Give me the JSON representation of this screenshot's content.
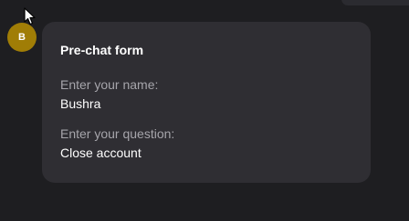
{
  "avatar": {
    "initial": "B",
    "color": "#a07d06"
  },
  "prechat_form": {
    "title": "Pre-chat form",
    "fields": [
      {
        "label": "Enter your name:",
        "value": "Bushra"
      },
      {
        "label": "Enter your question:",
        "value": "Close account"
      }
    ]
  },
  "icons": {
    "cursor": "mouse-pointer-icon"
  },
  "colors": {
    "background": "#1e1e21",
    "bubble": "#2f2e33",
    "label_text": "#a6a5ab",
    "value_text": "#ffffff"
  }
}
